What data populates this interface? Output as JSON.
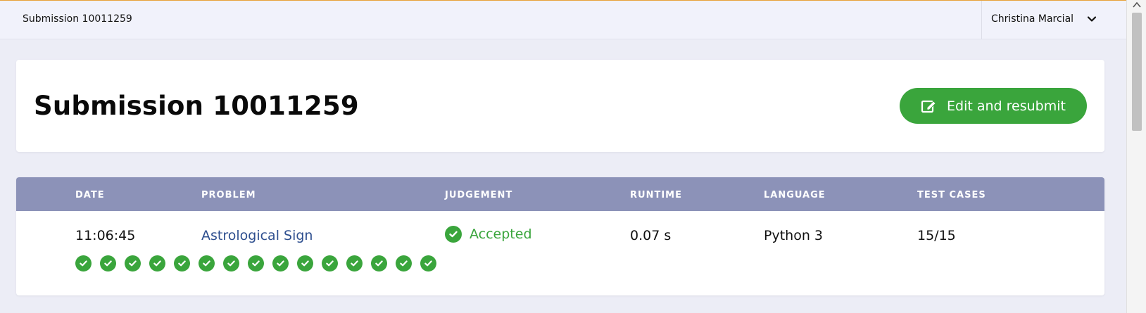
{
  "topbar": {
    "title": "Submission 10011259",
    "user_name": "Christina Marcial"
  },
  "header": {
    "title": "Submission 10011259",
    "resubmit_label": "Edit and resubmit"
  },
  "table": {
    "columns": [
      "DATE",
      "PROBLEM",
      "JUDGEMENT",
      "RUNTIME",
      "LANGUAGE",
      "TEST CASES"
    ],
    "row": {
      "date": "11:06:45",
      "problem": "Astrological Sign",
      "judgement": "Accepted",
      "runtime": "0.07 s",
      "language": "Python 3",
      "test_cases": "15/15"
    },
    "test_case_results": [
      "pass",
      "pass",
      "pass",
      "pass",
      "pass",
      "pass",
      "pass",
      "pass",
      "pass",
      "pass",
      "pass",
      "pass",
      "pass",
      "pass",
      "pass"
    ]
  },
  "colors": {
    "accent_green": "#3aa53c",
    "table_header": "#8c92b8",
    "link": "#2e4f8f"
  }
}
